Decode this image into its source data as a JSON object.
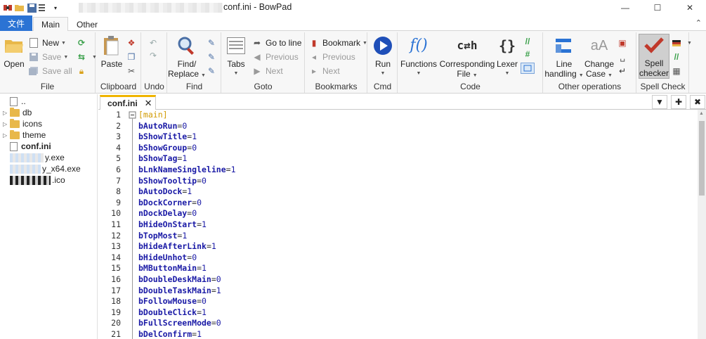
{
  "window": {
    "title": "conf.ini - BowPad",
    "minimize": "—",
    "maximize": "☐",
    "close": "✕"
  },
  "ribbon_tabs": [
    "文件",
    "Main",
    "Other"
  ],
  "ribbon": {
    "file": {
      "open": "Open",
      "new": "New",
      "save": "Save",
      "save_all": "Save all",
      "label": "File"
    },
    "clipboard": {
      "paste": "Paste",
      "label": "Clipboard"
    },
    "undo": {
      "label": "Undo"
    },
    "find": {
      "find_replace_1": "Find/",
      "find_replace_2": "Replace",
      "label": "Find"
    },
    "goto": {
      "tabs": "Tabs",
      "go_to_line": "Go to line",
      "previous": "Previous",
      "next": "Next",
      "label": "Goto"
    },
    "bookmarks": {
      "bookmark": "Bookmark",
      "previous": "Previous",
      "next": "Next",
      "label": "Bookmarks"
    },
    "cmd": {
      "run": "Run",
      "label": "Cmd"
    },
    "code": {
      "functions": "Functions",
      "corresponding_1": "Corresponding",
      "corresponding_2": "File",
      "lexer": "Lexer",
      "label": "Code"
    },
    "other": {
      "line_1": "Line",
      "line_2": "handling",
      "case_1": "Change",
      "case_2": "Case",
      "label": "Other operations"
    },
    "spell": {
      "spell_1": "Spell",
      "spell_2": "checker",
      "label": "Spell Check"
    }
  },
  "tree": {
    "items": [
      {
        "name": "..",
        "type": "file"
      },
      {
        "name": "db",
        "type": "folder"
      },
      {
        "name": "icons",
        "type": "folder"
      },
      {
        "name": "theme",
        "type": "folder"
      },
      {
        "name": "conf.ini",
        "type": "file"
      },
      {
        "name": "y.exe",
        "type": "file"
      },
      {
        "name": "y_x64.exe",
        "type": "file"
      },
      {
        "name": ".ico",
        "type": "file"
      }
    ]
  },
  "editor_tab": {
    "name": "conf.ini"
  },
  "lines": [
    {
      "n": "1",
      "section": "[main]"
    },
    {
      "n": "2",
      "key": "bAutoRun",
      "val": "0"
    },
    {
      "n": "3",
      "key": "bShowTitle",
      "val": "1"
    },
    {
      "n": "4",
      "key": "bShowGroup",
      "val": "0"
    },
    {
      "n": "5",
      "key": "bShowTag",
      "val": "1"
    },
    {
      "n": "6",
      "key": "bLnkNameSingleline",
      "val": "1"
    },
    {
      "n": "7",
      "key": "bShowTooltip",
      "val": "0"
    },
    {
      "n": "8",
      "key": "bAutoDock",
      "val": "1"
    },
    {
      "n": "9",
      "key": "bDockCorner",
      "val": "0"
    },
    {
      "n": "10",
      "key": "nDockDelay",
      "val": "0"
    },
    {
      "n": "11",
      "key": "bHideOnStart",
      "val": "1"
    },
    {
      "n": "12",
      "key": "bTopMost",
      "val": "1"
    },
    {
      "n": "13",
      "key": "bHideAfterLink",
      "val": "1"
    },
    {
      "n": "14",
      "key": "bHideUnhot",
      "val": "0"
    },
    {
      "n": "15",
      "key": "bMButtonMain",
      "val": "1"
    },
    {
      "n": "16",
      "key": "bDoubleDeskMain",
      "val": "0"
    },
    {
      "n": "17",
      "key": "bDoubleTaskMain",
      "val": "1"
    },
    {
      "n": "18",
      "key": "bFollowMouse",
      "val": "0"
    },
    {
      "n": "19",
      "key": "bDoubleClick",
      "val": "1"
    },
    {
      "n": "20",
      "key": "bFullScreenMode",
      "val": "0"
    },
    {
      "n": "21",
      "key": "bDelConfirm",
      "val": "1"
    }
  ]
}
